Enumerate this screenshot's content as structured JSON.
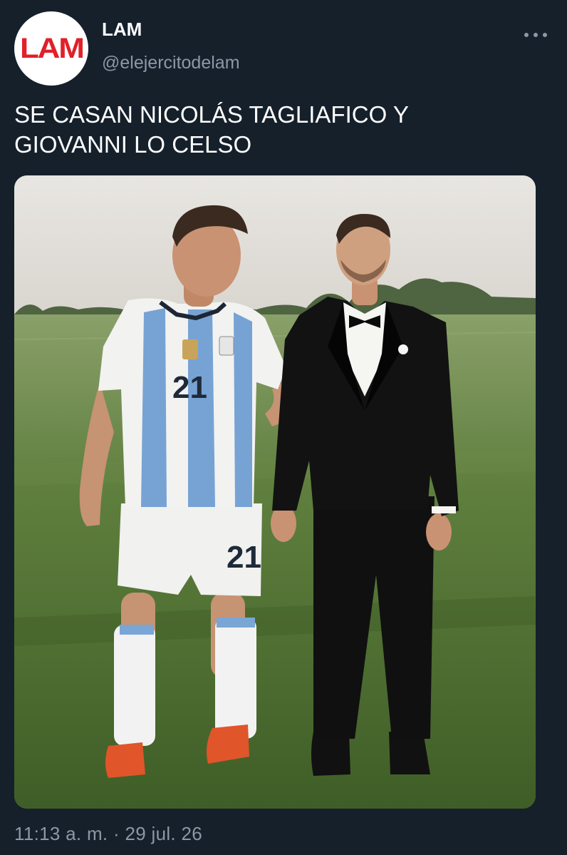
{
  "author": {
    "avatar_text": "LAM",
    "display_name": "LAM",
    "handle": "@elejercitodelam"
  },
  "tweet": {
    "text_line1": "SE CASAN NICOLÁS TAGLIAFICO Y",
    "text_line2": "GIOVANNI LO CELSO",
    "timestamp": "11:13 a. m. · 29 jul. 26"
  },
  "media": {
    "jersey_number_shirt": "21",
    "jersey_number_shorts": "21"
  },
  "icons": {
    "more": "more-horizontal-icon"
  },
  "colors": {
    "background": "#15202b",
    "secondary_text": "#8b98a5",
    "avatar_brand": "#e0202a"
  }
}
